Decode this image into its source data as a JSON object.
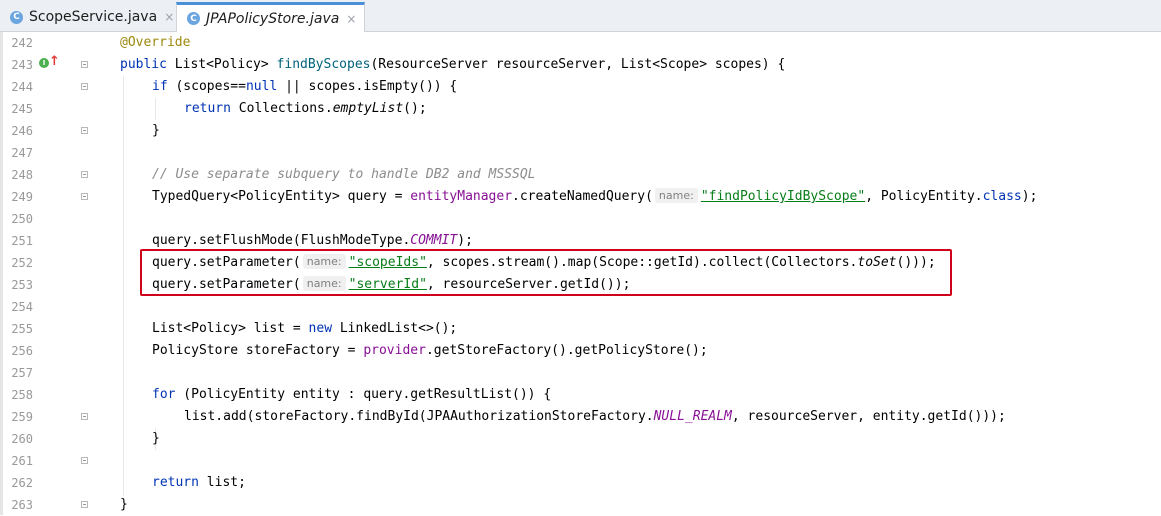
{
  "tabs": [
    {
      "label": "ScopeService.java",
      "icon": "class-icon",
      "active": false
    },
    {
      "label": "JPAPolicyStore.java",
      "icon": "class-icon",
      "active": true
    }
  ],
  "icons": {
    "class_glyph": "C",
    "close_glyph": "×",
    "override_glyph": "I",
    "override_arrow": "↑"
  },
  "line_numbers": [
    "242",
    "243",
    "244",
    "245",
    "246",
    "247",
    "248",
    "249",
    "250",
    "251",
    "252",
    "253",
    "254",
    "255",
    "256",
    "257",
    "258",
    "259",
    "260",
    "261",
    "262",
    "263"
  ],
  "code": {
    "l242": {
      "ann": "@Override"
    },
    "l243": {
      "kw1": "public",
      "t1": " List<Policy> ",
      "fn": "findByScopes",
      "t2": "(ResourceServer resourceServer, List<Scope> scopes) {"
    },
    "l244": {
      "kw1": "if",
      "t1": " (scopes==",
      "kw2": "null",
      "t2": " || scopes.isEmpty()) {"
    },
    "l245": {
      "kw1": "return",
      "t1": " Collections.",
      "ital": "emptyList",
      "t2": "();"
    },
    "l246": {
      "t1": "}"
    },
    "l248": {
      "cmt": "// Use separate subquery to handle DB2 and MSSSQL"
    },
    "l249": {
      "t1": "TypedQuery<PolicyEntity> query = ",
      "field": "entityManager",
      "t2": ".createNamedQuery(",
      "hint": "name:",
      "str": "\"findPolicyIdByScope\"",
      "t3": ", PolicyEntity.",
      "kw": "class",
      "t4": ");"
    },
    "l251": {
      "t1": "query.setFlushMode(FlushModeType.",
      "sfield": "COMMIT",
      "t2": ");"
    },
    "l252": {
      "t1": "query.setParameter(",
      "hint": "name:",
      "str": "\"scopeIds\"",
      "t2": ", scopes.stream().map(Scope::getId).collect(Collectors.",
      "ital": "toSet",
      "t3": "()));"
    },
    "l253": {
      "t1": "query.setParameter(",
      "hint": "name:",
      "str": "\"serverId\"",
      "t2": ", resourceServer.getId());"
    },
    "l255": {
      "t1": "List<Policy> list = ",
      "kw": "new",
      "t2": " LinkedList<>();"
    },
    "l256": {
      "t1": "PolicyStore storeFactory = ",
      "field": "provider",
      "t2": ".getStoreFactory().getPolicyStore();"
    },
    "l258": {
      "kw": "for",
      "t1": " (PolicyEntity entity : query.getResultList()) {"
    },
    "l259": {
      "t1": "list.add(storeFactory.findById(JPAAuthorizationStoreFactory.",
      "sfield": "NULL_REALM",
      "t2": ", resourceServer, entity.getId()));"
    },
    "l260": {
      "t1": "}"
    },
    "l262": {
      "kw": "return",
      "t1": " list;"
    },
    "l263": {
      "t1": "}"
    }
  },
  "colors": {
    "keyword": "#0033b3",
    "string": "#067d17",
    "field": "#871094",
    "annotation": "#9e880d",
    "method": "#00627a",
    "comment": "#8c8c8c",
    "highlight_box": "#d0021b",
    "tab_accent": "#4a90d9"
  }
}
